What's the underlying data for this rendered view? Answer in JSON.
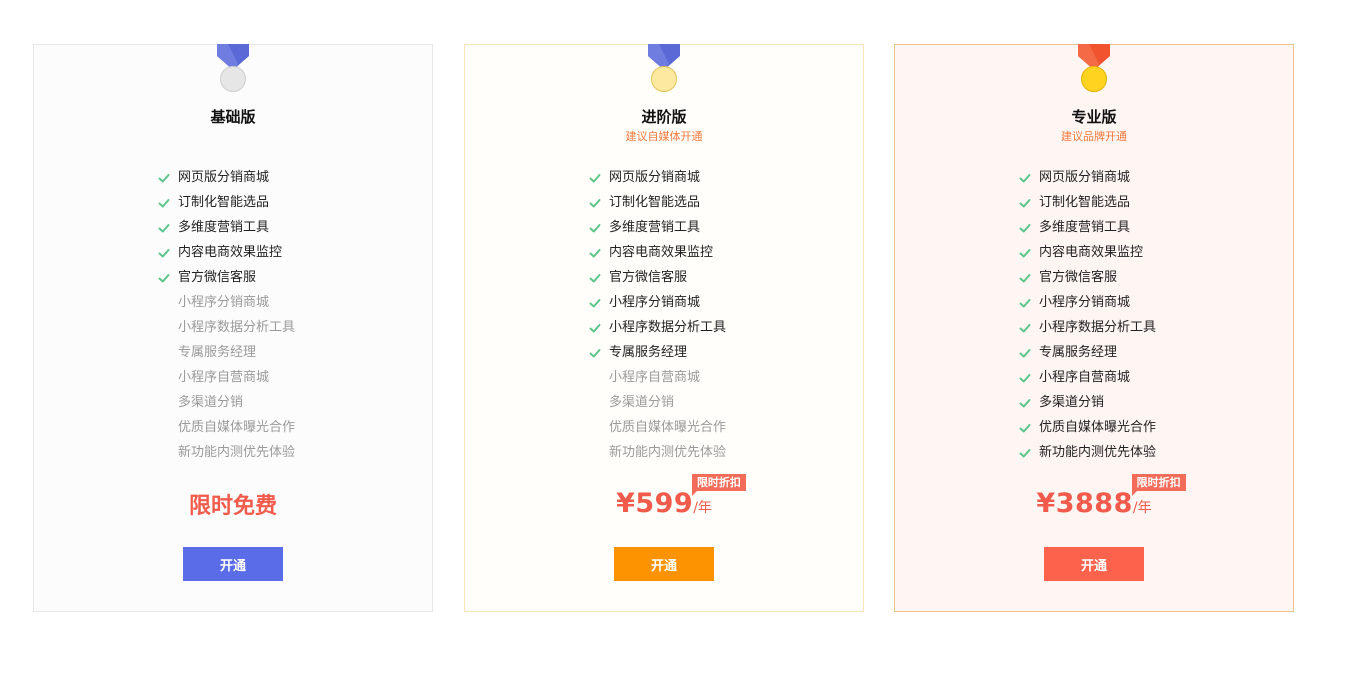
{
  "plans": [
    {
      "id": "basic",
      "title": "基础版",
      "subtitle": "",
      "medal": {
        "ribbon": "#5b69d6",
        "ribbon_dark": "#4653c0",
        "disc": "#e6e6e6",
        "disc_border": "#cfcfcf"
      },
      "features": [
        {
          "label": "网页版分销商城",
          "included": true
        },
        {
          "label": "订制化智能选品",
          "included": true
        },
        {
          "label": "多维度营销工具",
          "included": true
        },
        {
          "label": "内容电商效果监控",
          "included": true
        },
        {
          "label": "官方微信客服",
          "included": true
        },
        {
          "label": "小程序分销商城",
          "included": false
        },
        {
          "label": "小程序数据分析工具",
          "included": false
        },
        {
          "label": "专属服务经理",
          "included": false
        },
        {
          "label": "小程序自营商城",
          "included": false
        },
        {
          "label": "多渠道分销",
          "included": false
        },
        {
          "label": "优质自媒体曝光合作",
          "included": false
        },
        {
          "label": "新功能内测优先体验",
          "included": false
        }
      ],
      "price_text": "限时免费",
      "button_label": "开通",
      "button_color": "#5b6ce8"
    },
    {
      "id": "advanced",
      "title": "进阶版",
      "subtitle": "建议自媒体开通",
      "medal": {
        "ribbon": "#5b69d6",
        "ribbon_dark": "#4653c0",
        "disc": "#fde9a0",
        "disc_border": "#e7c45a"
      },
      "features": [
        {
          "label": "网页版分销商城",
          "included": true
        },
        {
          "label": "订制化智能选品",
          "included": true
        },
        {
          "label": "多维度营销工具",
          "included": true
        },
        {
          "label": "内容电商效果监控",
          "included": true
        },
        {
          "label": "官方微信客服",
          "included": true
        },
        {
          "label": "小程序分销商城",
          "included": true
        },
        {
          "label": "小程序数据分析工具",
          "included": true
        },
        {
          "label": "专属服务经理",
          "included": true
        },
        {
          "label": "小程序自营商城",
          "included": false
        },
        {
          "label": "多渠道分销",
          "included": false
        },
        {
          "label": "优质自媒体曝光合作",
          "included": false
        },
        {
          "label": "新功能内测优先体验",
          "included": false
        }
      ],
      "price_amount": "¥599",
      "price_unit": "/年",
      "discount_badge": "限时折扣",
      "button_label": "开通",
      "button_color": "#fd9300"
    },
    {
      "id": "pro",
      "title": "专业版",
      "subtitle": "建议品牌开通",
      "medal": {
        "ribbon": "#f0532e",
        "ribbon_dark": "#d9401c",
        "disc": "#ffd31f",
        "disc_border": "#e7b400"
      },
      "features": [
        {
          "label": "网页版分销商城",
          "included": true
        },
        {
          "label": "订制化智能选品",
          "included": true
        },
        {
          "label": "多维度营销工具",
          "included": true
        },
        {
          "label": "内容电商效果监控",
          "included": true
        },
        {
          "label": "官方微信客服",
          "included": true
        },
        {
          "label": "小程序分销商城",
          "included": true
        },
        {
          "label": "小程序数据分析工具",
          "included": true
        },
        {
          "label": "专属服务经理",
          "included": true
        },
        {
          "label": "小程序自营商城",
          "included": true
        },
        {
          "label": "多渠道分销",
          "included": true
        },
        {
          "label": "优质自媒体曝光合作",
          "included": true
        },
        {
          "label": "新功能内测优先体验",
          "included": true
        }
      ],
      "price_amount": "¥3888",
      "price_unit": "/年",
      "discount_badge": "限时折扣",
      "button_label": "开通",
      "button_color": "#fd634c"
    }
  ],
  "colors": {
    "check": "#5cc58a",
    "price": "#f25b4b",
    "subtitle": "#f07a3d"
  },
  "icons": {
    "check": "check-icon",
    "medal": "medal-icon"
  }
}
